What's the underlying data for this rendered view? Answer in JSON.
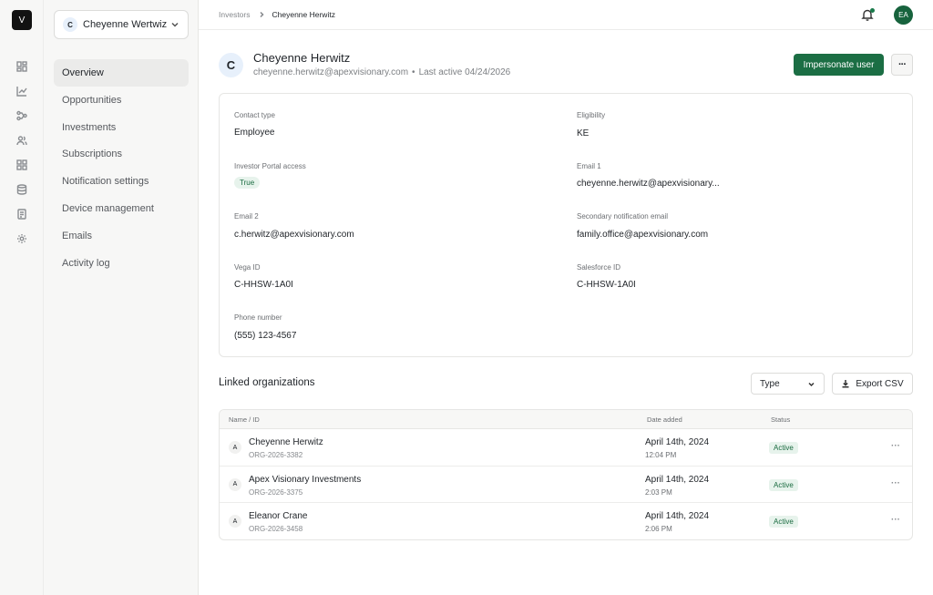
{
  "rail": {
    "logo": "V",
    "icons": [
      "dashboard-icon",
      "chart-icon",
      "flow-icon",
      "users-icon",
      "grid-icon",
      "database-icon",
      "document-icon",
      "gear-icon"
    ]
  },
  "workspace": {
    "avatar": "C",
    "name": "Cheyenne Wertwiz"
  },
  "nav": {
    "items": [
      {
        "label": "Overview",
        "active": true
      },
      {
        "label": "Opportunities"
      },
      {
        "label": "Investments"
      },
      {
        "label": "Subscriptions"
      },
      {
        "label": "Notification settings"
      },
      {
        "label": "Device management"
      },
      {
        "label": "Emails"
      },
      {
        "label": "Activity log"
      }
    ]
  },
  "breadcrumb": {
    "parent": "Investors",
    "current": "Cheyenne Herwitz"
  },
  "user_avatar": "EA",
  "profile": {
    "avatar": "C",
    "name": "Cheyenne Herwitz",
    "email": "cheyenne.herwitz@apexvisionary.com",
    "dot": "•",
    "last_active": "Last active 04/24/2026",
    "impersonate_label": "Impersonate user",
    "more_label": "···"
  },
  "fields": {
    "contact_type": {
      "label": "Contact type",
      "value": "Employee"
    },
    "eligibility": {
      "label": "Eligibility",
      "value": "KE"
    },
    "portal_access": {
      "label": "Investor Portal access",
      "value": "True"
    },
    "email1": {
      "label": "Email 1",
      "value": "cheyenne.herwitz@apexvisionary..."
    },
    "email2": {
      "label": "Email 2",
      "value": "c.herwitz@apexvisionary.com"
    },
    "secondary_email": {
      "label": "Secondary notification email",
      "value": "family.office@apexvisionary.com"
    },
    "vega_id": {
      "label": "Vega ID",
      "value": "C-HHSW-1A0I"
    },
    "salesforce_id": {
      "label": "Salesforce ID",
      "value": "C-HHSW-1A0I"
    },
    "phone": {
      "label": "Phone number",
      "value": "(555) 123-4567"
    }
  },
  "linked": {
    "title": "Linked organizations",
    "type_label": "Type",
    "export_label": "Export CSV",
    "headers": {
      "name": "Name / ID",
      "date": "Date added",
      "status": "Status"
    },
    "rows": [
      {
        "avatar": "A",
        "name": "Cheyenne Herwitz",
        "id": "ORG-2026-3382",
        "date": "April 14th, 2024",
        "time": "12:04 PM",
        "status": "Active",
        "menu": "···"
      },
      {
        "avatar": "A",
        "name": "Apex Visionary Investments",
        "id": "ORG-2026-3375",
        "date": "April 14th, 2024",
        "time": "2:03 PM",
        "status": "Active",
        "menu": "···"
      },
      {
        "avatar": "A",
        "name": "Eleanor Crane",
        "id": "ORG-2026-3458",
        "date": "April 14th, 2024",
        "time": "2:06 PM",
        "status": "Active",
        "menu": "···"
      }
    ]
  }
}
